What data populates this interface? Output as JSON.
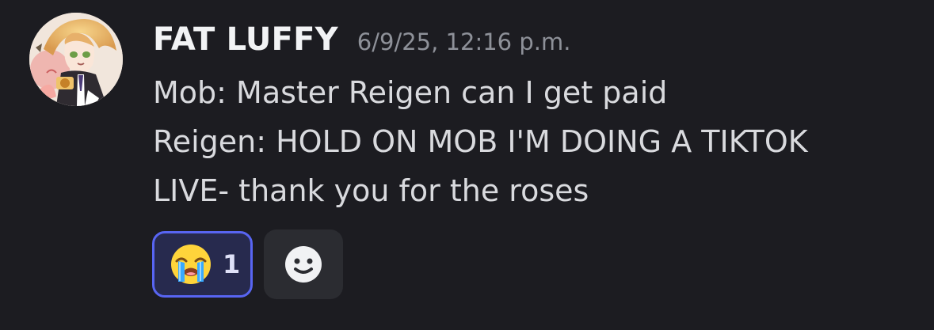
{
  "message": {
    "author": "FAT LUFFY",
    "timestamp": "6/9/25, 12:16 p.m.",
    "lines": [
      "Mob: Master Reigen can I get paid",
      "Reigen: HOLD ON MOB I'M DOING A TIKTOK",
      "LIVE- thank you for the roses"
    ],
    "reactions": [
      {
        "emoji": "loudly-crying-face",
        "count": "1",
        "selected": true
      }
    ],
    "add_reaction_icon": "smile-icon"
  },
  "colors": {
    "background": "#1c1c21",
    "username": "#f2f3f5",
    "timestamp": "#8e9199",
    "message_text": "#d9dade",
    "reaction_border": "#5865f2",
    "reaction_bg": "#272a4e",
    "add_reaction_bg": "#2b2c31"
  }
}
